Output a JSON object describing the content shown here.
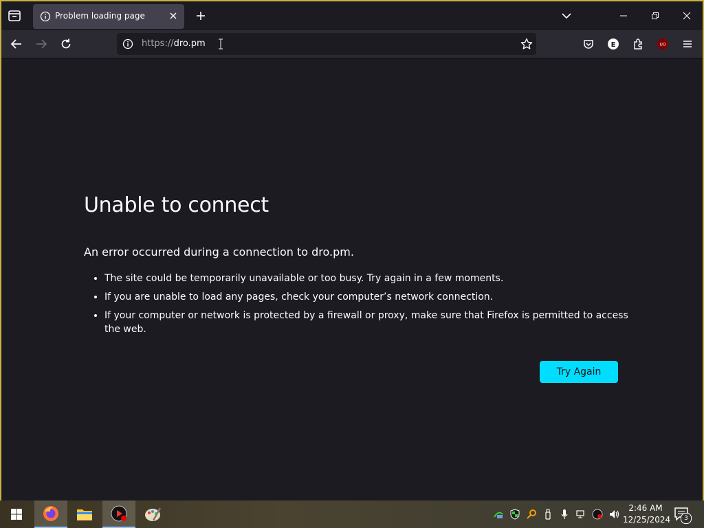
{
  "browser": {
    "tab": {
      "title": "Problem loading page"
    },
    "url": {
      "scheme": "https://",
      "host": "dro.pm"
    },
    "toolbar_icons": [
      "pocket-icon",
      "profile-icon",
      "extensions-icon",
      "ublock-icon",
      "menu-icon"
    ],
    "profile_letter": "E",
    "ublock_label": "UO"
  },
  "error_page": {
    "title": "Unable to connect",
    "lead": "An error occurred during a connection to dro.pm.",
    "reasons": [
      "The site could be temporarily unavailable or too busy. Try again in a few moments.",
      "If you are unable to load any pages, check your computer’s network connection.",
      "If your computer or network is protected by a firewall or proxy, make sure that Firefox is permitted to access the web."
    ],
    "try_again_label": "Try Again"
  },
  "taskbar": {
    "apps": [
      "firefox-icon",
      "file-explorer-icon",
      "media-player-icon",
      "paint-icon"
    ],
    "clock": {
      "time": "2:46 AM",
      "date": "12/25/2024"
    },
    "notification_count": "3"
  },
  "colors": {
    "accent": "#00ddff",
    "page_bg": "#1c1b22",
    "toolbar_bg": "#2b2a33",
    "tab_bg": "#42414d"
  }
}
